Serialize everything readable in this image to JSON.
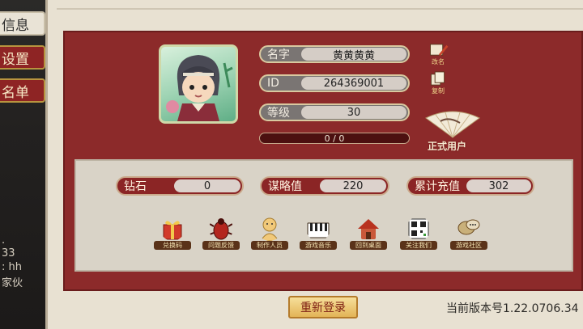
{
  "sidebar": {
    "tabs": [
      {
        "label": "信息"
      },
      {
        "label": "设置"
      },
      {
        "label": "名单"
      }
    ],
    "chat": [
      ".",
      "33",
      ": hh",
      "家伙"
    ]
  },
  "profile": {
    "name_label": "名字",
    "name_value": "黄黄黄黄",
    "id_label": "ID",
    "id_value": "264369001",
    "level_label": "等级",
    "level_value": "30",
    "progress_text": "0 / 0",
    "progress_fraction": 0,
    "rename_caption": "改名",
    "copy_caption": "复制",
    "account_type": "正式用户"
  },
  "stats": [
    {
      "label": "钻石",
      "value": "0"
    },
    {
      "label": "谋略值",
      "value": "220"
    },
    {
      "label": "累计充值",
      "value": "302"
    }
  ],
  "functions": [
    {
      "label": "兑换码",
      "icon": "gift-icon"
    },
    {
      "label": "问题反馈",
      "icon": "bug-icon"
    },
    {
      "label": "制作人员",
      "icon": "person-icon"
    },
    {
      "label": "游戏音乐",
      "icon": "piano-icon"
    },
    {
      "label": "回到桌面",
      "icon": "home-icon"
    },
    {
      "label": "关注我们",
      "icon": "qrcode-icon"
    },
    {
      "label": "游戏社区",
      "icon": "chat-bubble-icon"
    }
  ],
  "footer": {
    "relogin_label": "重新登录",
    "version_text": "当前版本号1.22.0706.34"
  },
  "colors": {
    "panel_red": "#8c2a2a",
    "parchment": "#e8e1d2",
    "gold": "#e3b457"
  }
}
